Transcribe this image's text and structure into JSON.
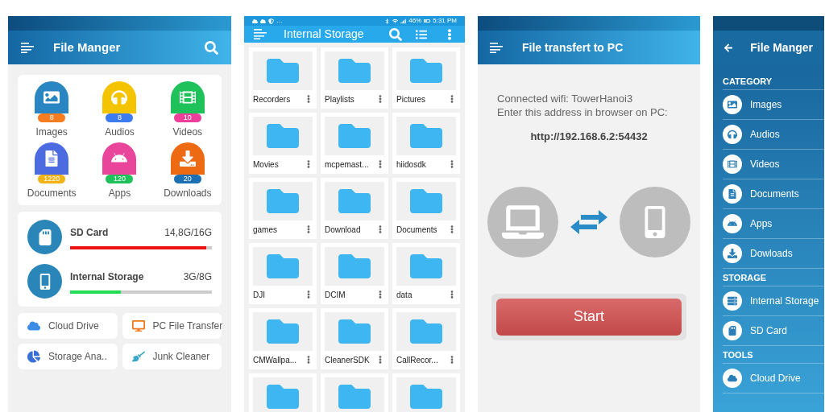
{
  "home_screen": {
    "title": "File Manger",
    "categories": [
      {
        "label": "Images",
        "count": "8",
        "kind": "images",
        "color": "#2a86c2"
      },
      {
        "label": "Audios",
        "count": "8",
        "kind": "audios",
        "color": "#f5c400"
      },
      {
        "label": "Videos",
        "count": "10",
        "kind": "videos",
        "color": "#1fc25a"
      },
      {
        "label": "Documents",
        "count": "1220",
        "kind": "documents",
        "color": "#4c6be0"
      },
      {
        "label": "Apps",
        "count": "120",
        "kind": "apps",
        "color": "#e9459b"
      },
      {
        "label": "Downloads",
        "count": "20",
        "kind": "downloads",
        "color": "#ee6a12"
      }
    ],
    "storages": [
      {
        "name": "SD Card",
        "kind": "sd",
        "reading": "14,8G/16G",
        "level": 0.96,
        "color": "#ee1111"
      },
      {
        "name": "Internal Storage",
        "kind": "phone",
        "reading": "3G/8G",
        "level": 0.36,
        "color": "#22dd55"
      }
    ],
    "tools": [
      {
        "label": "Cloud Drive",
        "kind": "cloud"
      },
      {
        "label": "PC File Transfer",
        "kind": "pc"
      },
      {
        "label": "Storage Ana..",
        "kind": "chart"
      },
      {
        "label": "Junk Cleaner",
        "kind": "broom"
      }
    ]
  },
  "storage_screen": {
    "status": {
      "more": "…",
      "battery": "46%",
      "time": "5:31 PM"
    },
    "title": "Internal Storage",
    "folders": [
      {
        "name": "Recorders"
      },
      {
        "name": "Playlists"
      },
      {
        "name": "Pictures"
      },
      {
        "name": "Movies"
      },
      {
        "name": "mcpemast..."
      },
      {
        "name": "hiidosdk"
      },
      {
        "name": "games"
      },
      {
        "name": "Download"
      },
      {
        "name": "Documents"
      },
      {
        "name": "DJI"
      },
      {
        "name": "DCIM"
      },
      {
        "name": "data"
      },
      {
        "name": "CMWallpa..."
      },
      {
        "name": "CleanerSDK"
      },
      {
        "name": "CallRecor..."
      }
    ]
  },
  "transfer_screen": {
    "title": "File transfert to PC",
    "lines": [
      "Connected wifi: TowerHanoi3",
      "Enter this address in browser on PC:"
    ],
    "address": "http://192.168.6.2:54432",
    "button": "Start"
  },
  "drawer_screen": {
    "title": "File Manger",
    "sections": [
      {
        "heading": "CATEGORY",
        "items": [
          {
            "label": "Images",
            "kind": "images"
          },
          {
            "label": "Audios",
            "kind": "audios"
          },
          {
            "label": "Videos",
            "kind": "videos"
          },
          {
            "label": "Documents",
            "kind": "documents"
          },
          {
            "label": "Apps",
            "kind": "apps"
          },
          {
            "label": "Dowloads",
            "kind": "downloads"
          }
        ]
      },
      {
        "heading": "STORAGE",
        "items": [
          {
            "label": "Internal Storage",
            "kind": "storage"
          },
          {
            "label": "SD Card",
            "kind": "sd"
          }
        ]
      },
      {
        "heading": "TOOLS",
        "items": [
          {
            "label": "Cloud Drive",
            "kind": "cloud"
          }
        ]
      }
    ]
  }
}
